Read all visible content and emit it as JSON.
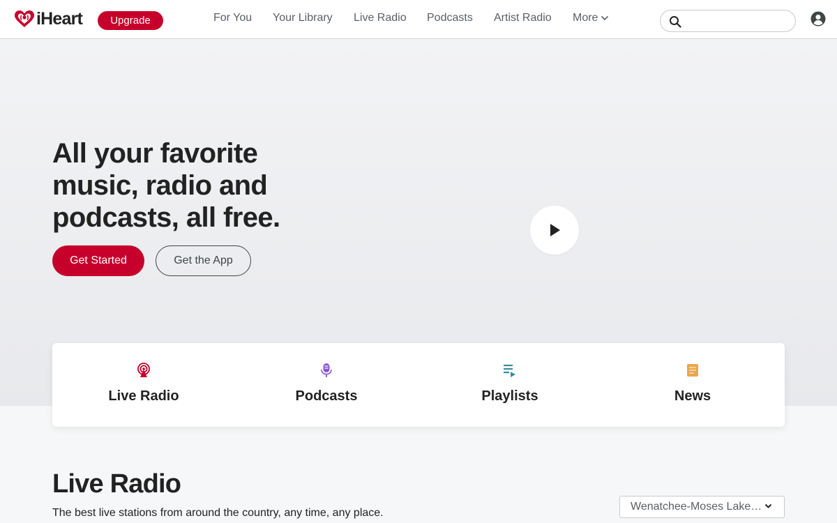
{
  "brand": {
    "name": "iHeart",
    "color": "#c6002b"
  },
  "header": {
    "upgrade_label": "Upgrade",
    "nav": [
      {
        "label": "For You"
      },
      {
        "label": "Your Library"
      },
      {
        "label": "Live Radio"
      },
      {
        "label": "Podcasts"
      },
      {
        "label": "Artist Radio"
      },
      {
        "label": "More"
      }
    ],
    "search": {
      "value": "",
      "placeholder": "",
      "icon": "search-icon"
    },
    "account_icon": "user-account-icon"
  },
  "hero": {
    "title": "All your favorite music, radio and podcasts, all free.",
    "primary_button": "Get Started",
    "secondary_button": "Get the App",
    "play_icon": "play-icon"
  },
  "categories": [
    {
      "label": "Live Radio",
      "icon": "radio-broadcast-icon",
      "color": "#c6002b"
    },
    {
      "label": "Podcasts",
      "icon": "microphone-icon",
      "color": "#8a55d6"
    },
    {
      "label": "Playlists",
      "icon": "playlist-icon",
      "color": "#3a8f9a"
    },
    {
      "label": "News",
      "icon": "newspaper-icon",
      "color": "#e8a74f"
    }
  ],
  "live_radio": {
    "title": "Live Radio",
    "subtitle": "The best live stations from around the country, any time, any place.",
    "market": "Wenatchee-Moses Lake…"
  }
}
